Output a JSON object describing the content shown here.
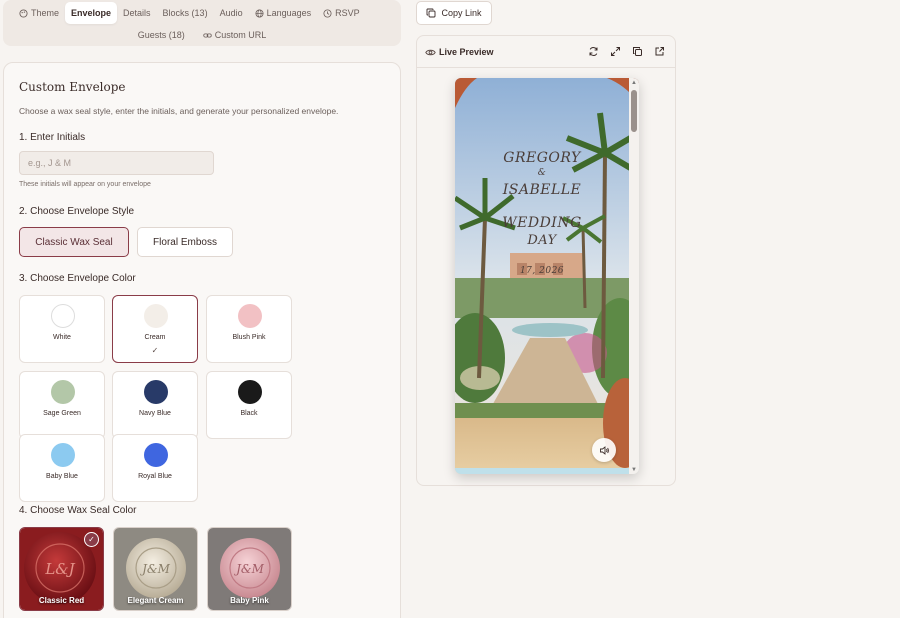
{
  "tabs_row1": [
    {
      "label": "Theme",
      "icon": "palette-icon",
      "active": false
    },
    {
      "label": "Envelope",
      "icon": "",
      "active": true
    },
    {
      "label": "Details",
      "icon": "",
      "active": false
    },
    {
      "label": "Blocks (13)",
      "icon": "",
      "active": false
    },
    {
      "label": "Audio",
      "icon": "",
      "active": false
    },
    {
      "label": "Languages",
      "icon": "globe-icon",
      "active": false
    },
    {
      "label": "RSVP",
      "icon": "clock-icon",
      "active": false
    }
  ],
  "tabs_row2": [
    {
      "label": "Guests (18)",
      "icon": ""
    },
    {
      "label": "Custom URL",
      "icon": "link-icon"
    }
  ],
  "panel": {
    "title": "Custom Envelope",
    "description": "Choose a wax seal style, enter the initials, and generate your personalized envelope.",
    "step1_label": "1. Enter Initials",
    "initials_placeholder": "e.g., J & M",
    "initials_value": "",
    "initials_hint": "These initials will appear on your envelope",
    "step2_label": "2. Choose Envelope Style",
    "styles": [
      {
        "label": "Classic Wax Seal",
        "selected": true
      },
      {
        "label": "Floral Emboss",
        "selected": false
      }
    ],
    "step3_label": "3. Choose Envelope Color",
    "colors": [
      {
        "label": "White",
        "hex": "#ffffff",
        "selected": false
      },
      {
        "label": "Cream",
        "hex": "#f3eee8",
        "selected": true
      },
      {
        "label": "Blush Pink",
        "hex": "#f2c1c4",
        "selected": false
      },
      {
        "label": "Sage Green",
        "hex": "#b3c7a8",
        "selected": false
      },
      {
        "label": "Navy Blue",
        "hex": "#283a68",
        "selected": false
      },
      {
        "label": "Black",
        "hex": "#1a1a1a",
        "selected": false
      },
      {
        "label": "Baby Blue",
        "hex": "#8ccaf0",
        "selected": false
      },
      {
        "label": "Royal Blue",
        "hex": "#3f66e0",
        "selected": false
      }
    ],
    "check_mark": "✓",
    "step4_label": "4. Choose Wax Seal Color",
    "seals": [
      {
        "label": "Classic Red",
        "monogram": "L&J",
        "selected": true
      },
      {
        "label": "Elegant Cream",
        "monogram": "J&M",
        "selected": false
      },
      {
        "label": "Baby Pink",
        "monogram": "J&M",
        "selected": false
      }
    ]
  },
  "copy_link_label": "Copy Link",
  "preview": {
    "title": "Live Preview",
    "name1": "GREGORY",
    "ampersand": "&",
    "name2": "ISABELLE",
    "line1": "WEDDING",
    "line2": "DAY",
    "date_partial": "17, 2026"
  },
  "colors": {
    "accent": "#8a3c48",
    "selected_bg": "#f3e6e7"
  }
}
